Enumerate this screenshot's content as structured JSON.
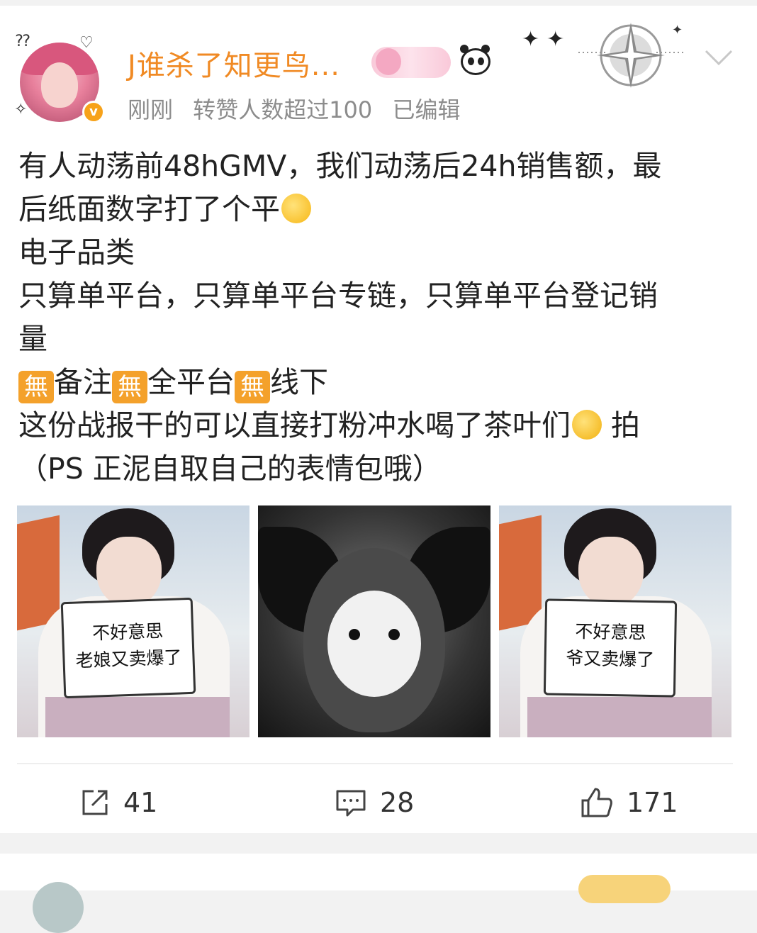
{
  "post": {
    "username": "J谁杀了知更鸟...",
    "time": "刚刚",
    "repost_note": "转赞人数超过100",
    "edited": "已编辑",
    "content_lines": [
      "有人动荡前48hGMV，我们动荡后24h销售额，最",
      "后纸面数字打了个平",
      "电子品类",
      "只算单平台，只算单平台专链，只算单平台登记销",
      "量",
      "备注",
      "全平台",
      "线下",
      "这份战报干的可以直接打粉冲水喝了茶叶们",
      " 拍",
      "（PS 正泥自取自己的表情包哦）"
    ],
    "wu_glyph": "無",
    "images": [
      {
        "sign_line1": "不好意思",
        "sign_line2": "老娘又卖爆了"
      },
      {},
      {
        "sign_line1": "不好意思",
        "sign_line2": "爷又卖爆了"
      }
    ]
  },
  "actions": {
    "repost_count": "41",
    "comment_count": "28",
    "like_count": "171"
  },
  "colors": {
    "username": "#f08a24",
    "meta": "#8c8c8c",
    "wu_badge": "#f4a12b"
  },
  "icons": {
    "repost": "share-arrow-icon",
    "comment": "comment-bubble-icon",
    "like": "thumbs-up-icon",
    "more": "chevron-down-icon"
  }
}
